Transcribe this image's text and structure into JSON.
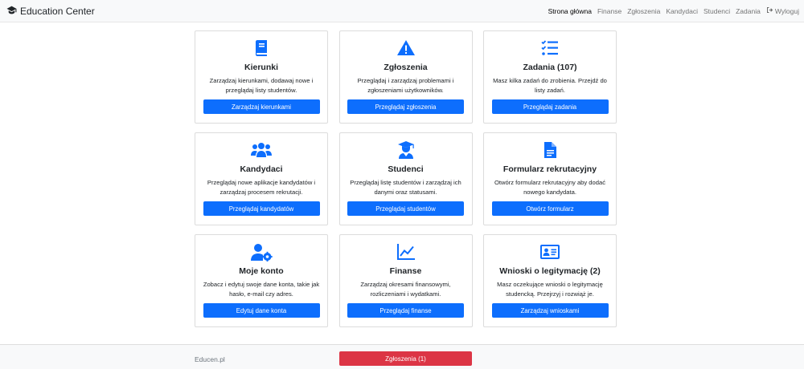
{
  "navbar": {
    "brand": "Education Center",
    "items": [
      "Strona główna",
      "Finanse",
      "Zgłoszenia",
      "Kandydaci",
      "Studenci",
      "Zadania"
    ],
    "logout": "Wyloguj"
  },
  "cards": [
    {
      "icon": "book-icon",
      "title": "Kierunki",
      "desc": "Zarządzaj kierunkami, dodawaj nowe i przeglądaj listy studentów.",
      "button": "Zarządzaj kierunkami"
    },
    {
      "icon": "warning-icon",
      "title": "Zgłoszenia",
      "desc": "Przeglądaj i zarządzaj problemami i zgłoszeniami użytkowników.",
      "button": "Przeglądaj zgłoszenia"
    },
    {
      "icon": "tasks-icon",
      "title": "Zadania (107)",
      "desc": "Masz kilka zadań do zrobienia. Przejdź do listy zadań.",
      "button": "Przeglądaj zadania"
    },
    {
      "icon": "users-icon",
      "title": "Kandydaci",
      "desc": "Przeglądaj nowe aplikacje kandydatów i zarządzaj procesem rekrutacji.",
      "button": "Przeglądaj kandydatów"
    },
    {
      "icon": "graduate-icon",
      "title": "Studenci",
      "desc": "Przeglądaj listę studentów i zarządzaj ich danymi oraz statusami.",
      "button": "Przeglądaj studentów"
    },
    {
      "icon": "document-icon",
      "title": "Formularz rekrutacyjny",
      "desc": "Otwórz formularz rekrutacyjny aby dodać nowego kandydata.",
      "button": "Otwórz formularz"
    },
    {
      "icon": "user-cog-icon",
      "title": "Moje konto",
      "desc": "Zobacz i edytuj swoje dane konta, takie jak hasło, e-mail czy adres.",
      "button": "Edytuj dane konta"
    },
    {
      "icon": "chart-line-icon",
      "title": "Finanse",
      "desc": "Zarządzaj okresami finansowymi, rozliczeniami i wydatkami.",
      "button": "Przeglądaj finanse"
    },
    {
      "icon": "id-card-icon",
      "title": "Wnioski o legitymację (2)",
      "desc": "Masz oczekujące wnioski o legitymację studencką. Przejrzyj i rozwiąż je.",
      "button": "Zarządzaj wnioskami"
    }
  ],
  "footer": {
    "copyright": "Educen.pl",
    "reports_button": "Zgłoszenia (1)"
  },
  "colors": {
    "primary": "#0d6efd",
    "danger": "#dc3545",
    "navbar_bg": "#f8f9fa"
  }
}
